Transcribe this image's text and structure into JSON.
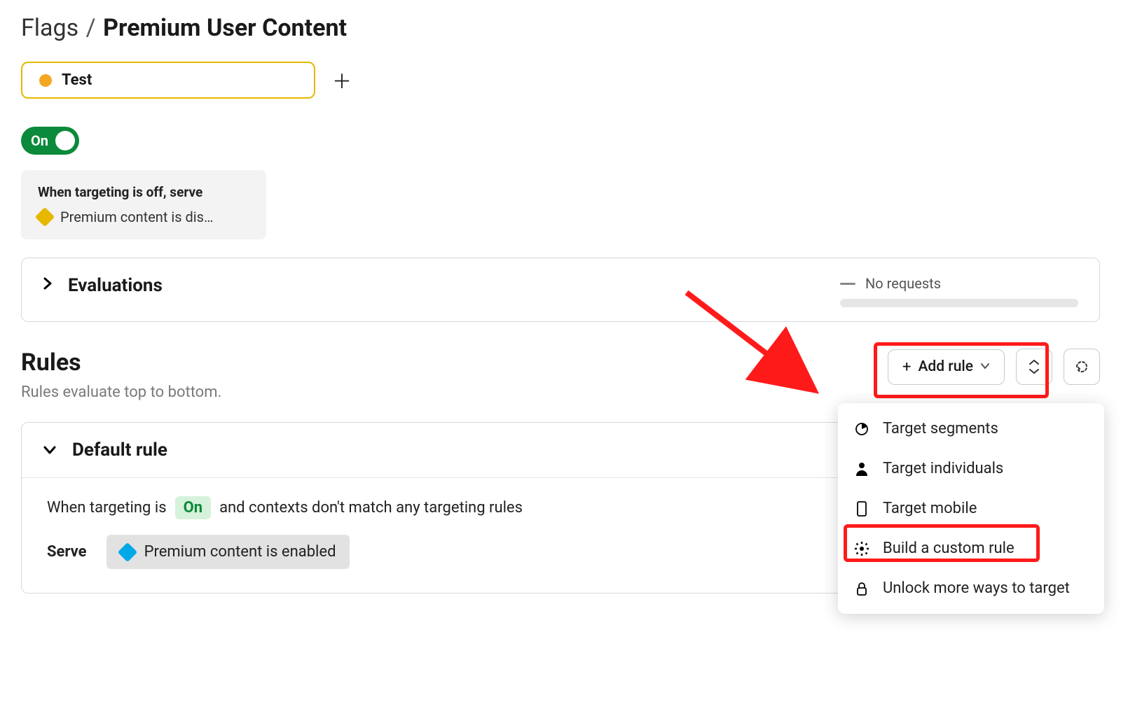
{
  "breadcrumb": {
    "parent": "Flags",
    "sep": "/",
    "current": "Premium User Content"
  },
  "env": {
    "name": "Test"
  },
  "toggle": {
    "label": "On"
  },
  "off_card": {
    "label": "When targeting is off, serve",
    "value": "Premium content is dis…"
  },
  "evaluations": {
    "title": "Evaluations",
    "no_requests": "No requests"
  },
  "rules": {
    "title": "Rules",
    "subtitle": "Rules evaluate top to bottom.",
    "add_rule_label": "Add rule"
  },
  "dropdown": {
    "items": [
      "Target segments",
      "Target individuals",
      "Target mobile",
      "Build a custom rule",
      "Unlock more ways to target"
    ]
  },
  "default_rule": {
    "title": "Default rule",
    "line_prefix": "When targeting is",
    "state": "On",
    "line_suffix": "and contexts don't match any targeting rules",
    "serve_label": "Serve",
    "serve_value": "Premium content is enabled"
  }
}
